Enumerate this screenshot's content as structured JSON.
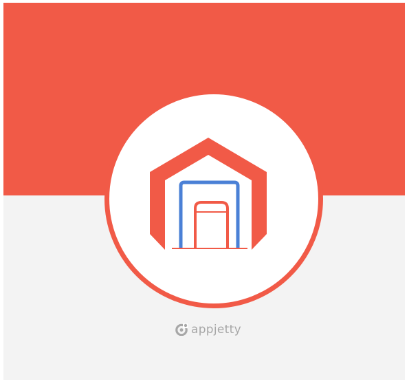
{
  "colors": {
    "primary_red": "#F15A47",
    "accent_blue": "#4A80D6",
    "band_gray": "#F3F3F3",
    "badge_white": "#FFFFFF",
    "brand_gray": "#A7A7A7"
  },
  "logo": {
    "wordmark": "appjetty",
    "icon": "appjetty-swirl-icon"
  },
  "emblem": {
    "icon": "warehouse-doors-icon"
  }
}
